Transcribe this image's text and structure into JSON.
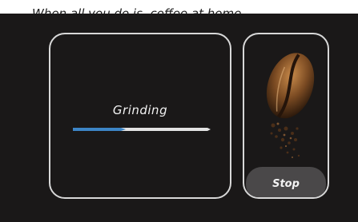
{
  "header_text": "When all you do is, coffee at home",
  "grinder": {
    "status_label": "Grinding",
    "progress_fraction": 0.39
  },
  "actions": {
    "stop_label": "Stop"
  },
  "colors": {
    "progress_fill": "#3d85c6",
    "progress_track": "#e3e3e3",
    "background": "#1a1818",
    "panel_border": "#d8d8d8",
    "button_bg": "#4a4849"
  },
  "icons": {
    "bean": "coffee-bean-icon"
  }
}
